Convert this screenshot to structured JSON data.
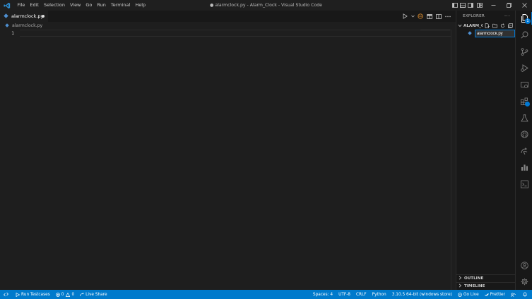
{
  "window": {
    "title": "● alarmclock.py - Alarm_Clock - Visual Studio Code"
  },
  "menu": [
    "File",
    "Edit",
    "Selection",
    "View",
    "Go",
    "Run",
    "Terminal",
    "Help"
  ],
  "editor": {
    "tab_label": "alarmclock.py",
    "breadcrumb_file": "alarmclock.py",
    "line_numbers": [
      "1"
    ]
  },
  "explorer": {
    "title": "EXPLORER",
    "more": "···",
    "folder_name": "ALARM_CLOCK",
    "rename_value": "alarmclock.py",
    "outline_label": "OUTLINE",
    "timeline_label": "TIMELINE"
  },
  "activity": {
    "explorer_badge": "1"
  },
  "statusbar": {
    "run_testcases": "Run Testcases",
    "errors": "0",
    "warnings": "0",
    "live_share": "Live Share",
    "spaces": "Spaces: 4",
    "encoding": "UTF-8",
    "eol": "CRLF",
    "language": "Python",
    "interpreter": "3.10.5 64-bit (windows store)",
    "go_live": "Go Live",
    "prettier": "Prettier"
  },
  "colors": {
    "accent": "#007acc",
    "focus_border": "#0078d4",
    "editor_bg": "#1e1e1e",
    "sidebar_bg": "#181818"
  }
}
